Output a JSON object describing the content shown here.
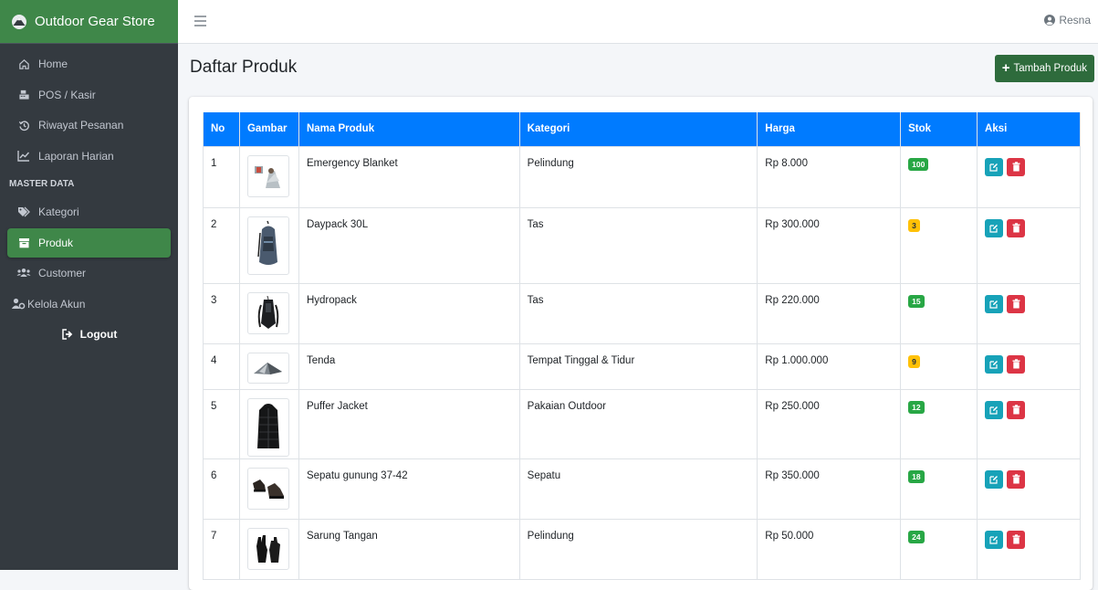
{
  "brand": {
    "name": "Outdoor Gear Store"
  },
  "sidebar": {
    "items": [
      {
        "label": "Home",
        "icon": "home-icon"
      },
      {
        "label": "POS / Kasir",
        "icon": "cash-register-icon"
      },
      {
        "label": "Riwayat Pesanan",
        "icon": "history-icon"
      },
      {
        "label": "Laporan Harian",
        "icon": "chart-line-icon"
      }
    ],
    "header": "MASTER DATA",
    "master_items": [
      {
        "label": "Kategori",
        "icon": "tags-icon"
      },
      {
        "label": "Produk",
        "icon": "box-icon",
        "active": true
      },
      {
        "label": "Customer",
        "icon": "users-icon"
      },
      {
        "label": "Kelola Akun",
        "icon": "user-cog-icon"
      }
    ],
    "logout": "Logout"
  },
  "topbar": {
    "user": "Resna"
  },
  "page": {
    "title": "Daftar Produk",
    "add_button": "Tambah Produk"
  },
  "table": {
    "headers": [
      "No",
      "Gambar",
      "Nama Produk",
      "Kategori",
      "Harga",
      "Stok",
      "Aksi"
    ],
    "rows": [
      {
        "no": "1",
        "name": "Emergency Blanket",
        "category": "Pelindung",
        "price": "Rp 8.000",
        "stock": "100",
        "stock_status": "ok"
      },
      {
        "no": "2",
        "name": "Daypack 30L",
        "category": "Tas",
        "price": "Rp 300.000",
        "stock": "3",
        "stock_status": "low"
      },
      {
        "no": "3",
        "name": "Hydropack",
        "category": "Tas",
        "price": "Rp 220.000",
        "stock": "15",
        "stock_status": "ok"
      },
      {
        "no": "4",
        "name": "Tenda",
        "category": "Tempat Tinggal & Tidur",
        "price": "Rp 1.000.000",
        "stock": "9",
        "stock_status": "low"
      },
      {
        "no": "5",
        "name": "Puffer Jacket",
        "category": "Pakaian Outdoor",
        "price": "Rp 250.000",
        "stock": "12",
        "stock_status": "ok"
      },
      {
        "no": "6",
        "name": "Sepatu gunung 37-42",
        "category": "Sepatu",
        "price": "Rp 350.000",
        "stock": "18",
        "stock_status": "ok"
      },
      {
        "no": "7",
        "name": "Sarung Tangan",
        "category": "Pelindung",
        "price": "Rp 50.000",
        "stock": "24",
        "stock_status": "ok"
      }
    ]
  },
  "colors": {
    "brand_green": "#3f8749",
    "sidebar_bg": "#343a40",
    "table_header": "#007bff",
    "badge_ok": "#28a745",
    "badge_low": "#ffc107",
    "edit": "#17a2b8",
    "delete": "#dc3545"
  }
}
